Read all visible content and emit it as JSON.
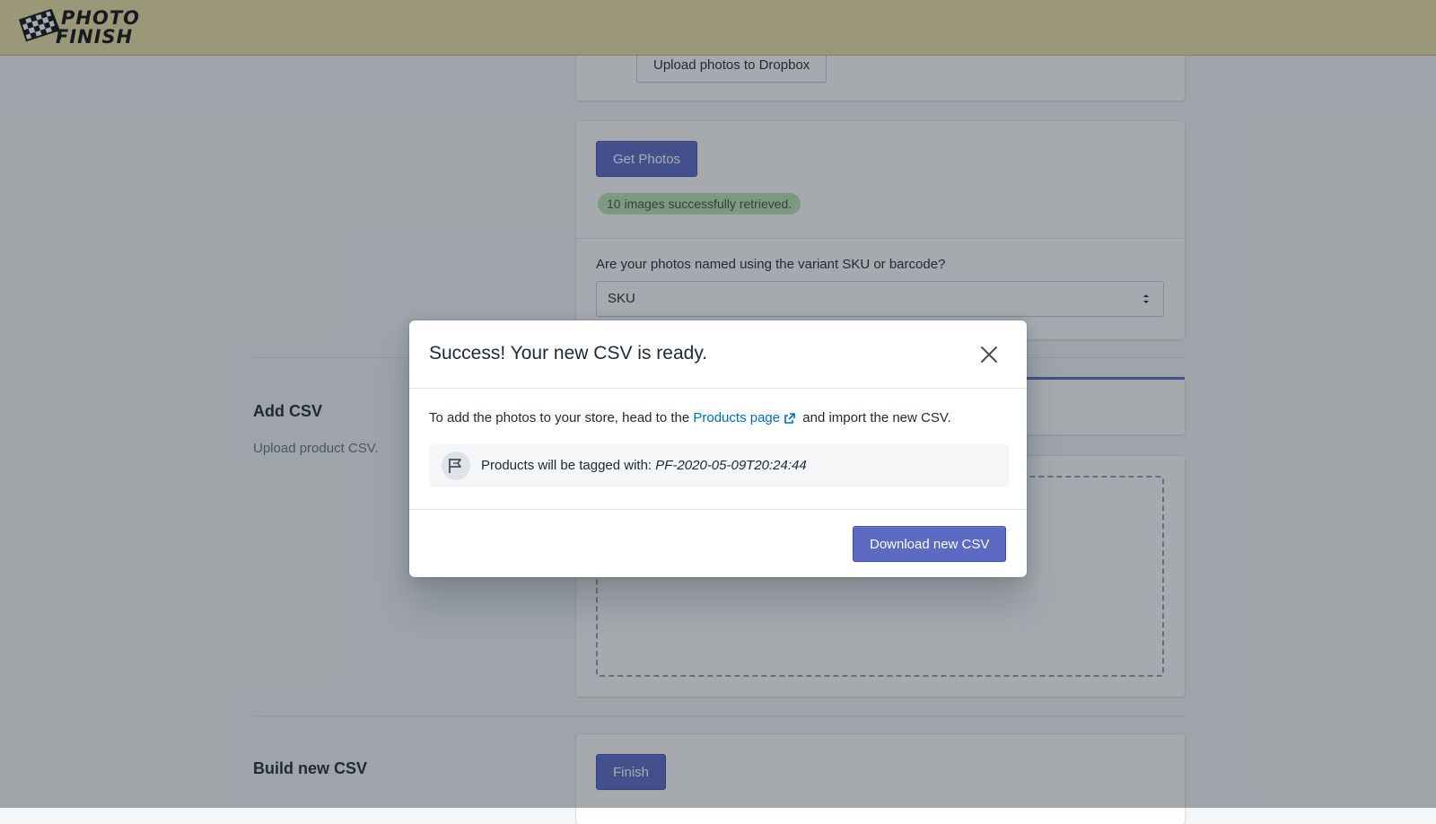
{
  "header": {
    "logo_line1": "PHOTO",
    "logo_line2": "FINISH"
  },
  "main": {
    "upload_button": "Upload photos to Dropbox",
    "get_photos_button": "Get Photos",
    "retrieved_badge": "10 images successfully retrieved.",
    "naming_question": "Are your photos named using the variant SKU or barcode?",
    "naming_select_value": "SKU",
    "add_csv_title": "Add CSV",
    "add_csv_desc": "Upload product CSV.",
    "build_csv_title": "Build new CSV",
    "finish_button": "Finish"
  },
  "modal": {
    "title": "Success! Your new CSV is ready.",
    "body_prefix": "To add the photos to your store, head to the",
    "link_text": "Products page",
    "body_suffix": "and import the new CSV.",
    "tag_label": "Products will be tagged with:",
    "tag_value": "PF-2020-05-09T20:24:44",
    "download_button": "Download new CSV"
  },
  "colors": {
    "header_bg": "#eddfa5",
    "primary": "#5c6ac4",
    "link": "#006fbb",
    "success_badge": "#bbe5b3"
  },
  "icons": [
    "checkered-flag-icon",
    "select-arrows-icon",
    "close-icon",
    "external-link-icon",
    "tag-flag-icon"
  ]
}
